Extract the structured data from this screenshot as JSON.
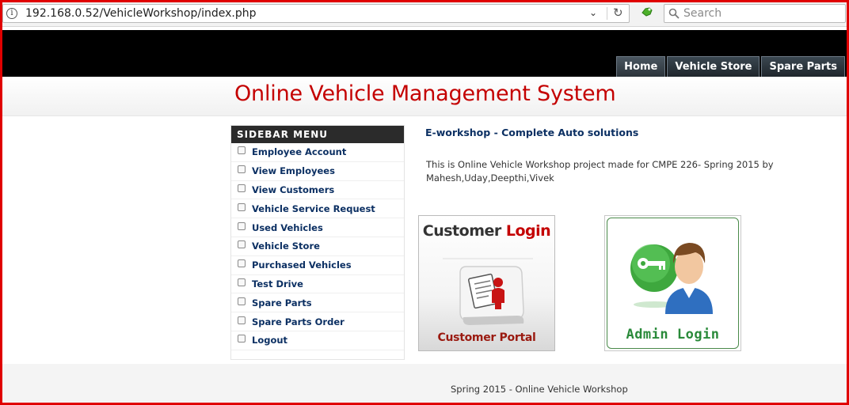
{
  "browser": {
    "url": "192.168.0.52/VehicleWorkshop/index.php",
    "search_placeholder": "Search",
    "icons": {
      "info": "info-icon",
      "dropdown": "chevron-down-icon",
      "reload": "reload-icon",
      "addon": "addon-icon",
      "search": "search-icon"
    }
  },
  "header": {
    "nav": [
      {
        "label": "Home"
      },
      {
        "label": "Vehicle Store"
      },
      {
        "label": "Spare Parts"
      }
    ],
    "title": "Online Vehicle Management System",
    "title_color": "#c40000"
  },
  "sidebar": {
    "heading": "SIDEBAR MENU",
    "items": [
      {
        "label": "Employee Account"
      },
      {
        "label": "View Employees"
      },
      {
        "label": "View Customers"
      },
      {
        "label": "Vehicle Service Request"
      },
      {
        "label": "Used Vehicles"
      },
      {
        "label": "Vehicle Store"
      },
      {
        "label": "Purchased Vehicles"
      },
      {
        "label": "Test Drive"
      },
      {
        "label": "Spare Parts"
      },
      {
        "label": "Spare Parts Order"
      },
      {
        "label": "Logout"
      }
    ]
  },
  "main": {
    "heading": "E-workshop - Complete Auto solutions",
    "description": "This is Online Vehicle Workshop project made for CMPE 226- Spring 2015 by Mahesh,Uday,Deepthi,Vivek",
    "customer_card": {
      "title_part1": "Customer",
      "title_part2": "Login",
      "caption": "Customer Portal"
    },
    "admin_card": {
      "caption": "Admin Login"
    }
  },
  "footer": {
    "text": "Spring 2015 - Online Vehicle Workshop"
  }
}
